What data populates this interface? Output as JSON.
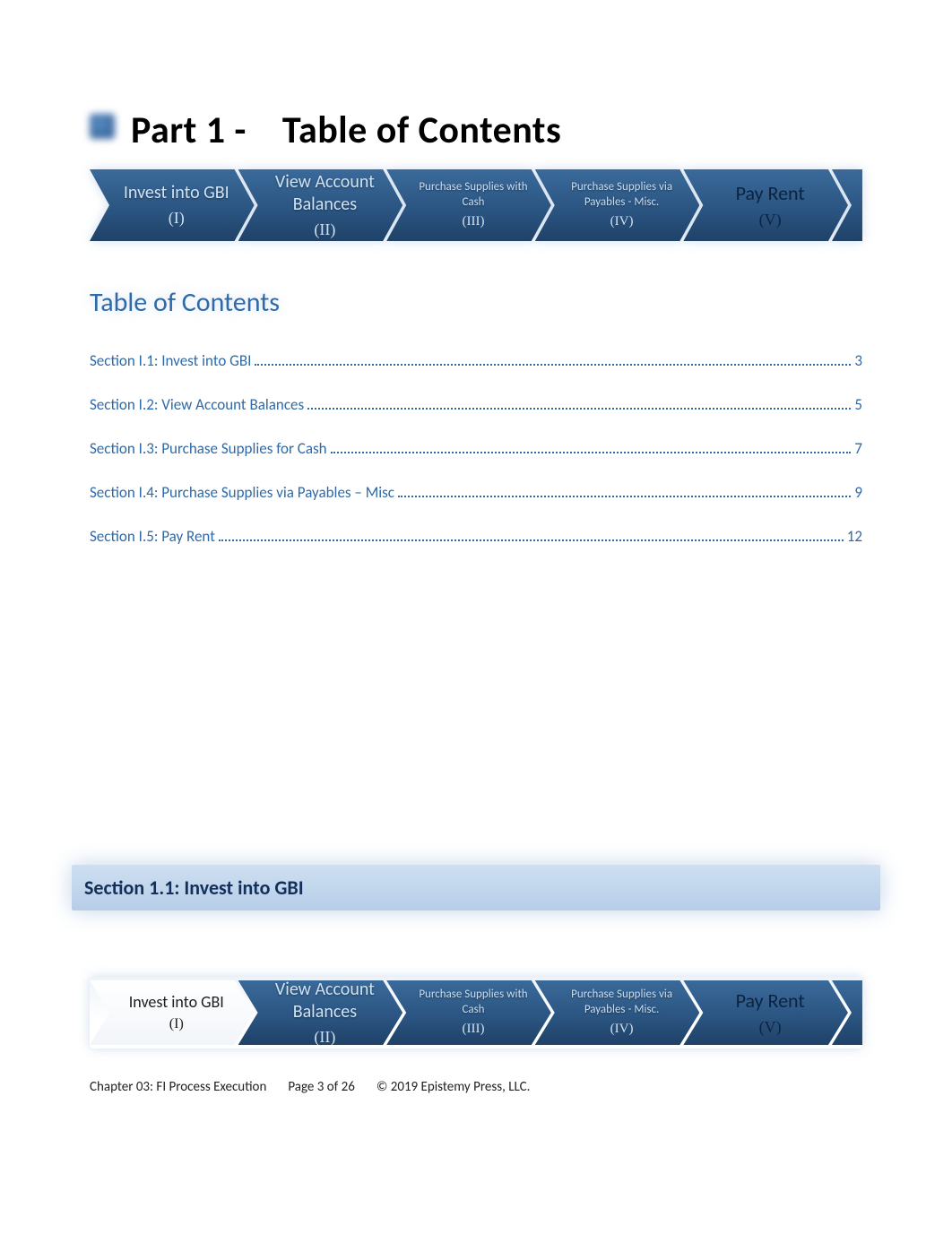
{
  "page_title_part1": "Part 1 -",
  "page_title_part2": "Table of Contents",
  "steps": [
    {
      "title": "Invest into GBI",
      "num": "(I)"
    },
    {
      "title": "View Account Balances",
      "num": "(II)"
    },
    {
      "title": "Purchase Supplies with Cash",
      "num": "(III)"
    },
    {
      "title": "Purchase Supplies via Payables - Misc.",
      "num": "(IV)"
    },
    {
      "title": "Pay Rent",
      "num": "(V)"
    }
  ],
  "toc_heading": "Table of Contents",
  "toc": [
    {
      "label": "Section I.1: Invest into GBI",
      "page": "3"
    },
    {
      "label": "Section I.2: View Account Balances",
      "page": "5"
    },
    {
      "label": "Section I.3: Purchase Supplies for Cash",
      "page": "7"
    },
    {
      "label": "Section I.4: Purchase Supplies via Payables – Misc",
      "page": "9"
    },
    {
      "label": "Section I.5: Pay Rent",
      "page": "12"
    }
  ],
  "section_heading": "Section 1.1: Invest into GBI",
  "footer": {
    "chapter": "Chapter 03: FI Process Execution",
    "page": "Page 3 of 26",
    "copyright": "© 2019 Epistemy Press, LLC."
  }
}
